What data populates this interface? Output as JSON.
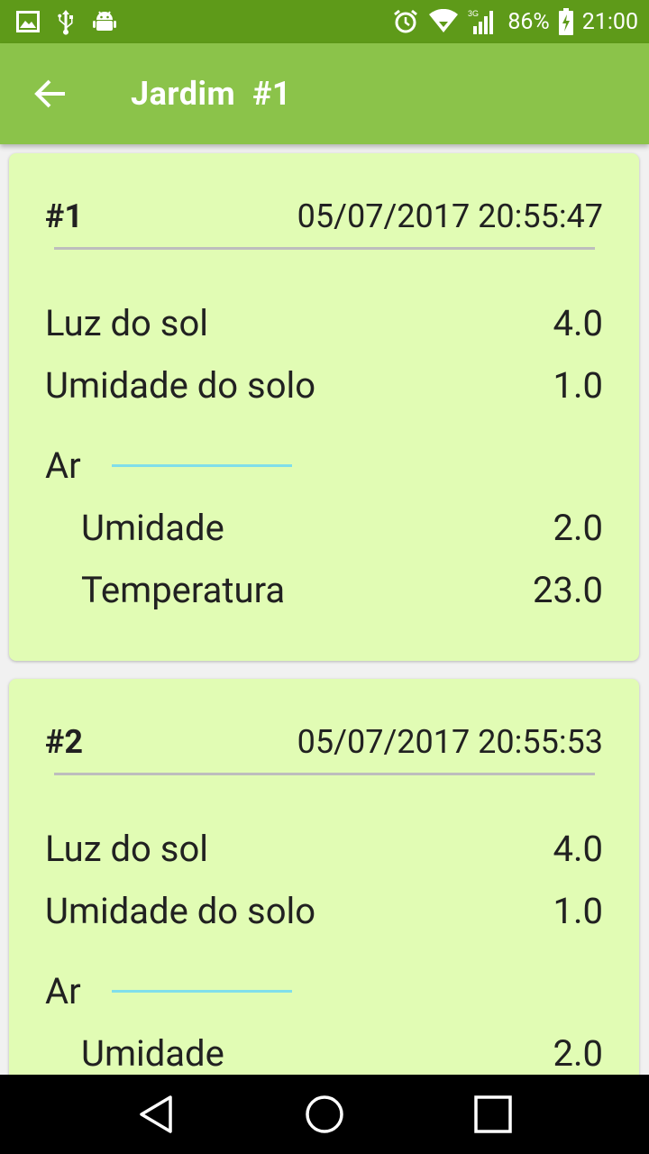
{
  "status_bar": {
    "battery": "86%",
    "time": "21:00",
    "network": "3G",
    "icons": [
      "image-icon",
      "usb-icon",
      "android-icon",
      "alarm-icon",
      "wifi-icon",
      "signal-icon",
      "battery-charging-icon"
    ]
  },
  "app_bar": {
    "title": "Jardim  #1",
    "back_icon": "arrow-back-icon"
  },
  "readings": [
    {
      "id": "#1",
      "timestamp": "05/07/2017 20:55:47",
      "sunlight_label": "Luz do sol",
      "sunlight_value": "4.0",
      "soil_label": "Umidade do solo",
      "soil_value": "1.0",
      "air_label": "Ar",
      "air_humidity_label": "Umidade",
      "air_humidity_value": "2.0",
      "air_temp_label": "Temperatura",
      "air_temp_value": "23.0"
    },
    {
      "id": "#2",
      "timestamp": "05/07/2017 20:55:53",
      "sunlight_label": "Luz do sol",
      "sunlight_value": "4.0",
      "soil_label": "Umidade do solo",
      "soil_value": "1.0",
      "air_label": "Ar",
      "air_humidity_label": "Umidade",
      "air_humidity_value": "2.0"
    }
  ],
  "nav_bar": {
    "icons": [
      "back-triangle-icon",
      "home-circle-icon",
      "recents-square-icon"
    ]
  },
  "colors": {
    "status_bar": "#5e9a19",
    "app_bar": "#8bc34a",
    "card": "#e1fcb4",
    "air_accent": "#80deea"
  }
}
